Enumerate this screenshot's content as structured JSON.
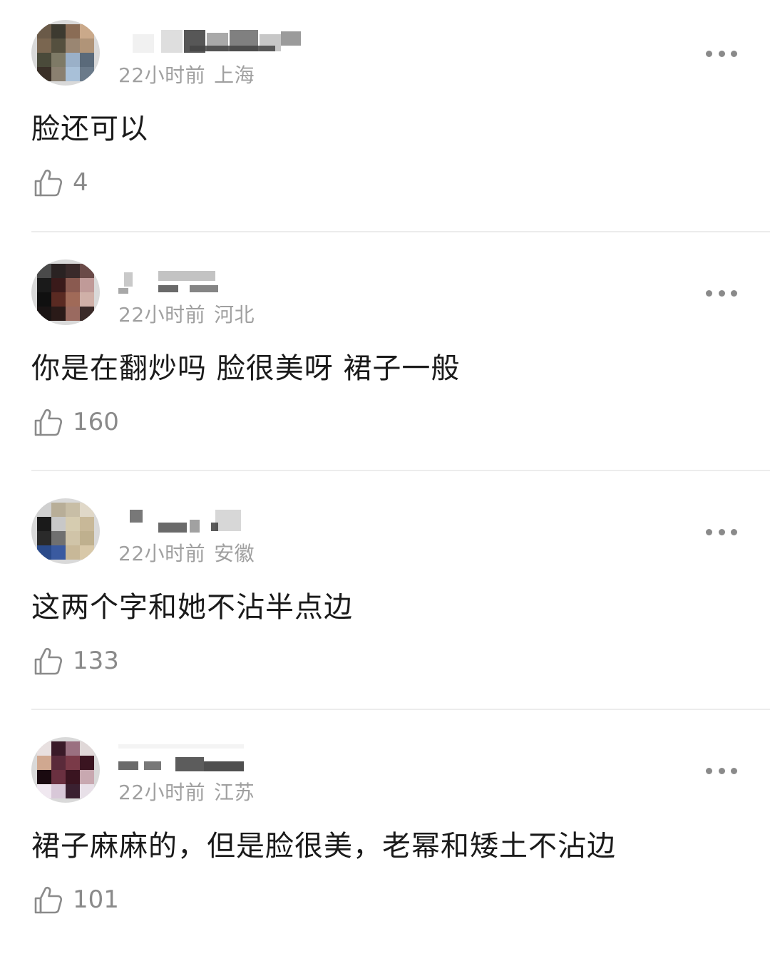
{
  "comments": [
    {
      "time": "22小时前",
      "location": "上海",
      "text": "脸还可以",
      "likes": "4",
      "avatar": [
        "#6a5a48",
        "#3d3a30",
        "#8a6c55",
        "#caa98a",
        "#7a6650",
        "#55503f",
        "#9a8672",
        "#b09478",
        "#4a4a3a",
        "#7e7a66",
        "#9ab0c8",
        "#5a6a7a",
        "#3a3028",
        "#8a8070",
        "#a8c0d8",
        "#6a7a8a"
      ]
    },
    {
      "time": "22小时前",
      "location": "河北",
      "text": "你是在翻炒吗 脸很美呀 裙子一般",
      "likes": "160",
      "avatar": [
        "#4a4a4a",
        "#2a2222",
        "#3a2a2a",
        "#6a4a48",
        "#1a1a1a",
        "#3a1a1a",
        "#8a5a50",
        "#c09a98",
        "#101010",
        "#5a2a22",
        "#a06a58",
        "#d0b0a8",
        "#1a1414",
        "#2a1a18",
        "#9a6a60",
        "#3a2a28"
      ]
    },
    {
      "time": "22小时前",
      "location": "安徽",
      "text": "这两个字和她不沾半点边",
      "likes": "133",
      "avatar": [
        "#d0d0d0",
        "#b8ae98",
        "#c8bea6",
        "#e0d8c8",
        "#1a1a1a",
        "#c8c8c8",
        "#d6ccb0",
        "#c8b898",
        "#2a2a2a",
        "#707070",
        "#d0c4a8",
        "#bfb08e",
        "#2a4a8a",
        "#3a5aa0",
        "#c8b898",
        "#d8c8a8"
      ]
    },
    {
      "time": "22小时前",
      "location": "江苏",
      "text": "裙子麻麻的，但是脸很美，老幂和矮土不沾边",
      "likes": "101",
      "avatar": [
        "#e8e0e0",
        "#3a1a28",
        "#9a7080",
        "#e0d8d8",
        "#d0a890",
        "#5a2a3a",
        "#7a3a48",
        "#3a1420",
        "#1a0a10",
        "#6a3040",
        "#3a1420",
        "#c8a8b0",
        "#f0e8f0",
        "#d8c8d8",
        "#3a2030",
        "#e8e0e8"
      ]
    }
  ],
  "colors": {
    "meta": "#a0a0a0",
    "text": "#1a1a1a",
    "divider": "#ececec",
    "icon": "#8a8a8a"
  }
}
